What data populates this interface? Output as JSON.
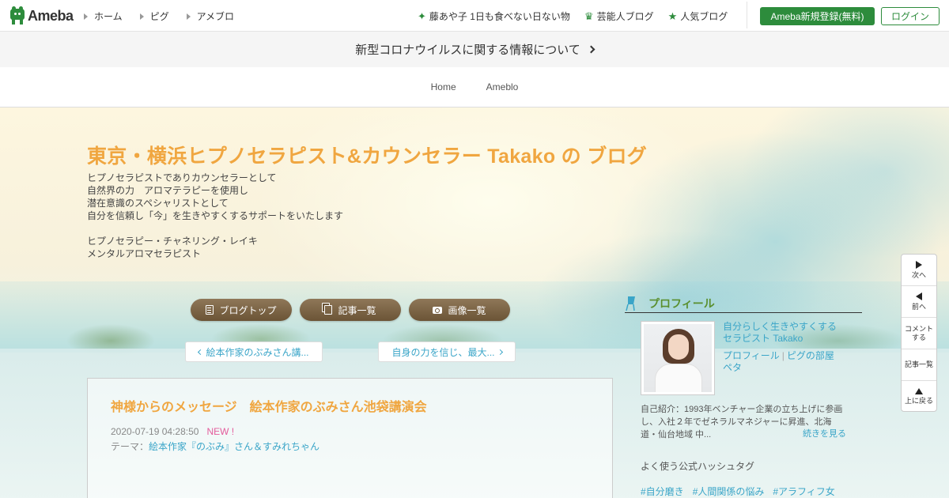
{
  "header": {
    "logo_text": "Ameba",
    "nav": [
      {
        "label": "ホーム"
      },
      {
        "label": "ピグ"
      },
      {
        "label": "アメブロ"
      }
    ],
    "right_links": [
      {
        "label": "藤あや子 1日も食べない日ない物",
        "icon": "sparkle-icon"
      },
      {
        "label": "芸能人ブログ",
        "icon": "crown-icon"
      },
      {
        "label": "人気ブログ",
        "icon": "star-icon"
      }
    ],
    "register_label": "Ameba新規登録(無料)",
    "login_label": "ログイン",
    "accent_color": "#2d8c3c"
  },
  "notice": {
    "text": "新型コロナウイルスに関する情報について"
  },
  "blog_nav": [
    {
      "label": "Home"
    },
    {
      "label": "Ameblo"
    }
  ],
  "blog": {
    "title": "東京・横浜ヒプノセラピスト&カウンセラー Takako の ブログ",
    "description_lines": [
      "ヒプノセラピストでありカウンセラーとして",
      "自然界の力　アロマテラピーを使用し",
      "潜在意識のスペシャリストとして",
      "自分を信頼し「今」を生きやすくするサポートをいたします",
      "",
      "ヒプノセラピー・チャネリング・レイキ",
      "メンタルアロマセラピスト"
    ],
    "title_color": "#f0a640"
  },
  "menu_buttons": {
    "blog_top": "ブログトップ",
    "article_list": "記事一覧",
    "image_list": "画像一覧"
  },
  "article_nav": {
    "prev": "絵本作家のぶみさん講...",
    "next": "自身の力を信じ、最大..."
  },
  "article": {
    "title": "神様からのメッセージ　絵本作家のぶみさん池袋講演会",
    "date": "2020-07-19 04:28:50",
    "badge": "NEW !",
    "theme_label": "テーマ：",
    "theme": "絵本作家『のぶみ』さん＆すみれちゃん"
  },
  "profile": {
    "heading": "プロフィール",
    "name": "自分らしく生きやすくするセラピスト Takako",
    "link_profile": "プロフィール",
    "link_pig": "ピグの部屋",
    "link_peta": "ペタ",
    "intro": "自己紹介：1993年ベンチャー企業の立ち上げに参画し、入社２年でゼネラルマネジャーに昇進、北海道・仙台地域 中...",
    "more": "続きを見る",
    "hashtag_heading": "よく使う公式ハッシュタグ",
    "hashtags": [
      "#自分磨き",
      "#人間関係の悩み",
      "#アラフィフ女"
    ]
  },
  "side_nav": {
    "next": "次へ",
    "prev": "前へ",
    "comment": "コメントする",
    "list": "記事一覧",
    "top": "上に戻る"
  }
}
